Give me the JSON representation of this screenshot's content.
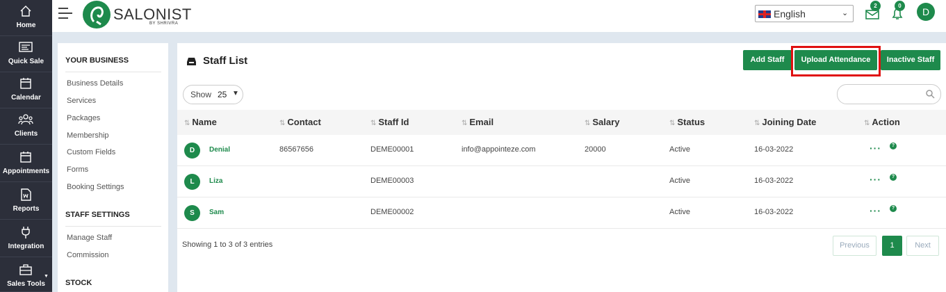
{
  "nav": {
    "items": [
      {
        "label": "Home",
        "icon": "home-icon"
      },
      {
        "label": "Quick Sale",
        "icon": "receipt-icon"
      },
      {
        "label": "Calendar",
        "icon": "calendar-icon"
      },
      {
        "label": "Clients",
        "icon": "users-icon"
      },
      {
        "label": "Appointments",
        "icon": "calendar-icon"
      },
      {
        "label": "Reports",
        "icon": "report-icon"
      },
      {
        "label": "Integration",
        "icon": "plug-icon"
      },
      {
        "label": "Sales Tools",
        "icon": "briefcase-icon"
      }
    ]
  },
  "brand": {
    "name": "SALONIST",
    "sub": "BY SHRIVRA",
    "color": "#1e8a4c"
  },
  "topbar": {
    "language": "English",
    "mail_badge": "2",
    "bell_badge": "0",
    "avatar": "D"
  },
  "sidemenu": {
    "your_business": "YOUR BUSINESS",
    "business_items": [
      "Business Details",
      "Services",
      "Packages",
      "Membership",
      "Custom Fields",
      "Forms",
      "Booking Settings"
    ],
    "staff_settings": "STAFF SETTINGS",
    "staff_items": [
      "Manage Staff",
      "Commission"
    ],
    "stock": "STOCK"
  },
  "panel": {
    "title": "Staff List",
    "add_staff": "Add Staff",
    "upload_attendance": "Upload Attendance",
    "inactive_staff": "Inactive Staff",
    "show_label": "Show",
    "show_value": "25",
    "search_placeholder": ""
  },
  "table": {
    "headers": [
      "Name",
      "Contact",
      "Staff Id",
      "Email",
      "Salary",
      "Status",
      "Joining Date",
      "Action"
    ],
    "rows": [
      {
        "initial": "D",
        "name": "Denial",
        "contact": "86567656",
        "staff_id": "DEME00001",
        "email": "info@appointeze.com",
        "salary": "20000",
        "status": "Active",
        "joining_date": "16-03-2022"
      },
      {
        "initial": "L",
        "name": "Liza",
        "contact": "",
        "staff_id": "DEME00003",
        "email": "",
        "salary": "",
        "status": "Active",
        "joining_date": "16-03-2022"
      },
      {
        "initial": "S",
        "name": "Sam",
        "contact": "",
        "staff_id": "DEME00002",
        "email": "",
        "salary": "",
        "status": "Active",
        "joining_date": "16-03-2022"
      }
    ],
    "action_dots": "···",
    "action_help": "?"
  },
  "footer": {
    "showing": "Showing 1 to 3 of 3 entries",
    "previous": "Previous",
    "page": "1",
    "next": "Next"
  }
}
